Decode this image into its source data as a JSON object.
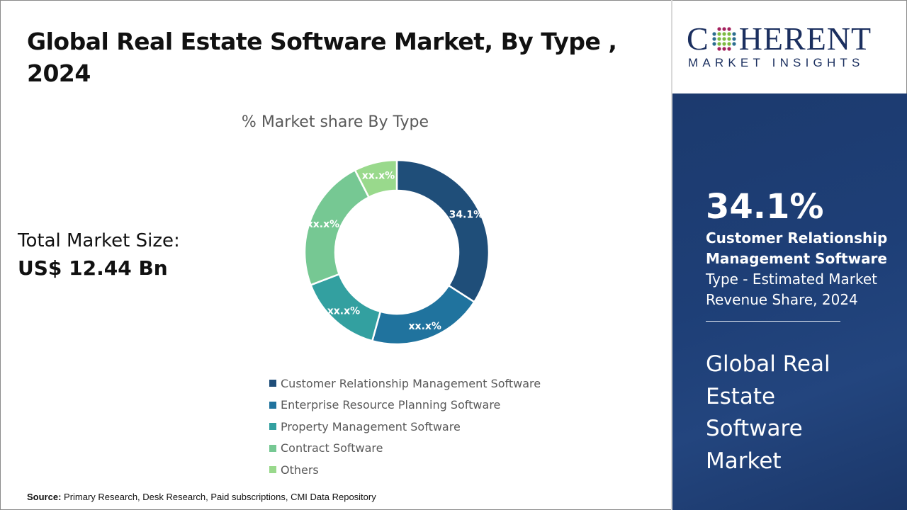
{
  "title": "Global Real Estate Software Market, By Type , 2024",
  "total_market": {
    "label": "Total Market Size:",
    "value": "US$ 12.44 Bn"
  },
  "source": {
    "label": "Source:",
    "text": " Primary Research, Desk Research, Paid subscriptions, CMI Data Repository"
  },
  "logo": {
    "main_left": "C",
    "main_right": "HERENT",
    "sub": "MARKET INSIGHTS",
    "icon": "globe-dots-icon"
  },
  "highlight": {
    "percent": "34.1%",
    "segment": "Customer Relationship Management Software",
    "description": "Type - Estimated Market Revenue Share, 2024",
    "market_name": "Global Real Estate Software Market"
  },
  "colors": {
    "brand_navy": "#1b2f5f",
    "panel_blue": "#1e3f77"
  },
  "chart_data": {
    "type": "pie",
    "variant": "donut",
    "title": "% Market share By Type",
    "categories": [
      "Customer Relationship Management Software",
      "Enterprise Resource Planning Software",
      "Property Management Software",
      "Contract Software",
      "Others"
    ],
    "values": [
      34.1,
      20.2,
      14.9,
      23.3,
      7.5
    ],
    "labels": [
      "34.1%",
      "xx.x%",
      "xx.x%",
      "xx.x%",
      "xx.x%"
    ],
    "colors": [
      "#1f4e79",
      "#20739e",
      "#33a0a0",
      "#76c893",
      "#99d98c"
    ],
    "legend_position": "bottom"
  }
}
